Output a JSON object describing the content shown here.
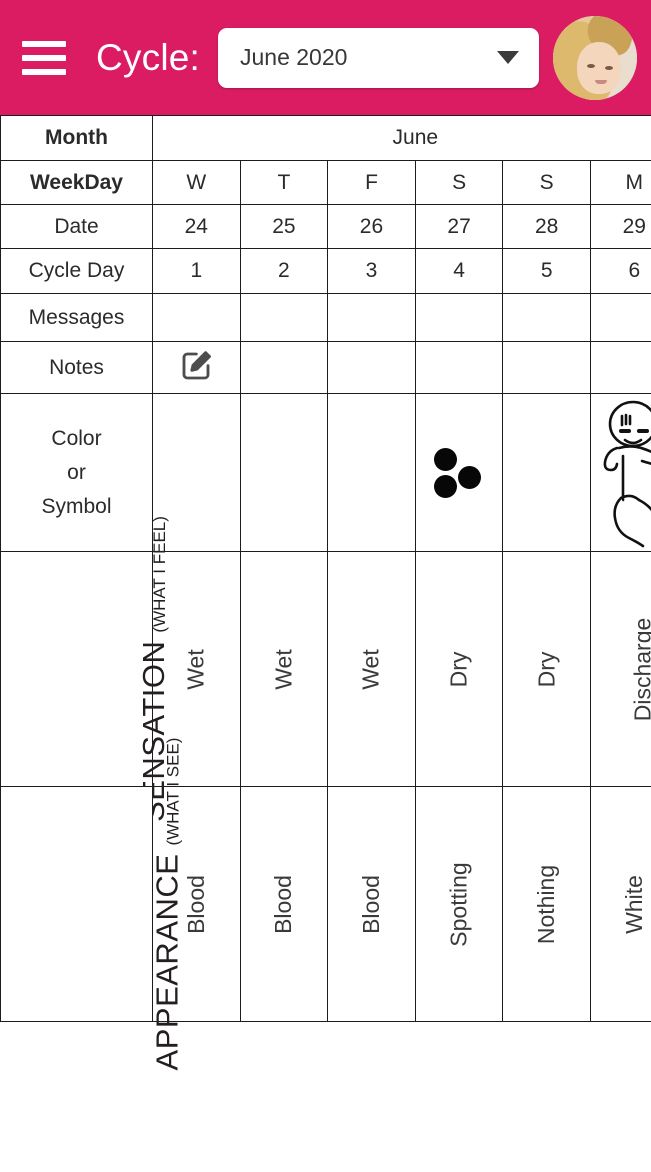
{
  "header": {
    "menu_icon": "hamburger-icon",
    "title": "Cycle:",
    "cycle_select_value": "June 2020",
    "cycle_select_icon": "chevron-down-icon",
    "avatar_label": "user-avatar",
    "background_color": "#DB1C63"
  },
  "table": {
    "row_labels": {
      "month": "Month",
      "weekday": "WeekDay",
      "date": "Date",
      "cycle_day": "Cycle Day",
      "messages": "Messages",
      "notes": "Notes",
      "color_symbol_line1": "Color",
      "color_symbol_line2": "or",
      "color_symbol_line3": "Symbol",
      "sensation_main": "SENSATION",
      "sensation_sub": "(WHAT I FEEL)",
      "appearance_main": "APPEARANCE",
      "appearance_sub": "(WHAT I SEE)"
    },
    "month_name": "June",
    "columns": [
      {
        "weekday": "W",
        "date": "24",
        "cycle_day": "1",
        "message": "",
        "note_icon": "edit-note-icon",
        "symbol_type": "color",
        "symbol_color": "#EE1D24",
        "symbol_glyph": "",
        "sensation": "Wet",
        "appearance": "Blood"
      },
      {
        "weekday": "T",
        "date": "25",
        "cycle_day": "2",
        "message": "",
        "note_icon": "",
        "symbol_type": "color",
        "symbol_color": "#EE1D24",
        "symbol_glyph": "",
        "sensation": "Wet",
        "appearance": "Blood"
      },
      {
        "weekday": "F",
        "date": "26",
        "cycle_day": "3",
        "message": "",
        "note_icon": "",
        "symbol_type": "color",
        "symbol_color": "#EE1D24",
        "symbol_glyph": "",
        "sensation": "Wet",
        "appearance": "Blood"
      },
      {
        "weekday": "S",
        "date": "27",
        "cycle_day": "4",
        "message": "",
        "note_icon": "",
        "symbol_type": "dots",
        "symbol_color": "#EE1D24",
        "symbol_glyph": "three-dots-spotting-icon",
        "sensation": "Dry",
        "appearance": "Spotting"
      },
      {
        "weekday": "S",
        "date": "28",
        "cycle_day": "5",
        "message": "",
        "note_icon": "",
        "symbol_type": "color",
        "symbol_color": "#22A44B",
        "symbol_glyph": "",
        "sensation": "Dry",
        "appearance": "Nothing"
      },
      {
        "weekday": "M",
        "date": "29",
        "cycle_day": "6",
        "message": "",
        "note_icon": "",
        "symbol_type": "baby",
        "symbol_color": "#FFFFFF",
        "symbol_glyph": "baby-icon",
        "sensation": "Discharge",
        "appearance": "White"
      }
    ],
    "colors": {
      "label_background": "#FBE3EA",
      "cycle_day_background": "#F8C0D3",
      "border": "#1C1C1C",
      "blood_red": "#EE1D24",
      "fertile_green": "#22A44B"
    }
  }
}
